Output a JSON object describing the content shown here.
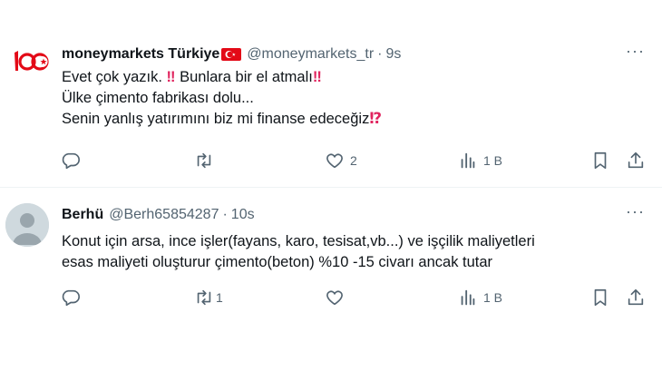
{
  "tweets": [
    {
      "author_name": "moneymarkets Türkiye",
      "handle": "@moneymarkets_tr",
      "separator": "·",
      "time": "9s",
      "avatar_text": "100",
      "lines": [
        {
          "text": "Evet çok yazık. ",
          "emoji1": "‼",
          "text2": " Bunlara bir el atmalı",
          "emoji2": "‼"
        },
        {
          "text": "Ülke çimento fabrikası dolu..."
        },
        {
          "text": "Senin yanlış yatırımını biz mi finanse edeceğiz",
          "emoji1": "⁉"
        }
      ],
      "reply_count": "",
      "retweet_count": "",
      "like_count": "2",
      "views_count": "1 B"
    },
    {
      "author_name": "Berhü",
      "handle": "@Berh65854287",
      "separator": "·",
      "time": "10s",
      "lines": [
        {
          "text": "Konut için arsa, ince işler(fayans, karo, tesisat,vb...) ve işçilik maliyetleri"
        },
        {
          "text": "esas maliyeti oluşturur çimento(beton) %10 -15 civarı ancak tutar"
        }
      ],
      "reply_count": "",
      "retweet_count": "1",
      "like_count": "",
      "views_count": "1 B"
    }
  ],
  "more_label": "···",
  "colors": {
    "accent_red": "#e0245e",
    "flag_red": "#e30a17",
    "muted": "#536471"
  }
}
